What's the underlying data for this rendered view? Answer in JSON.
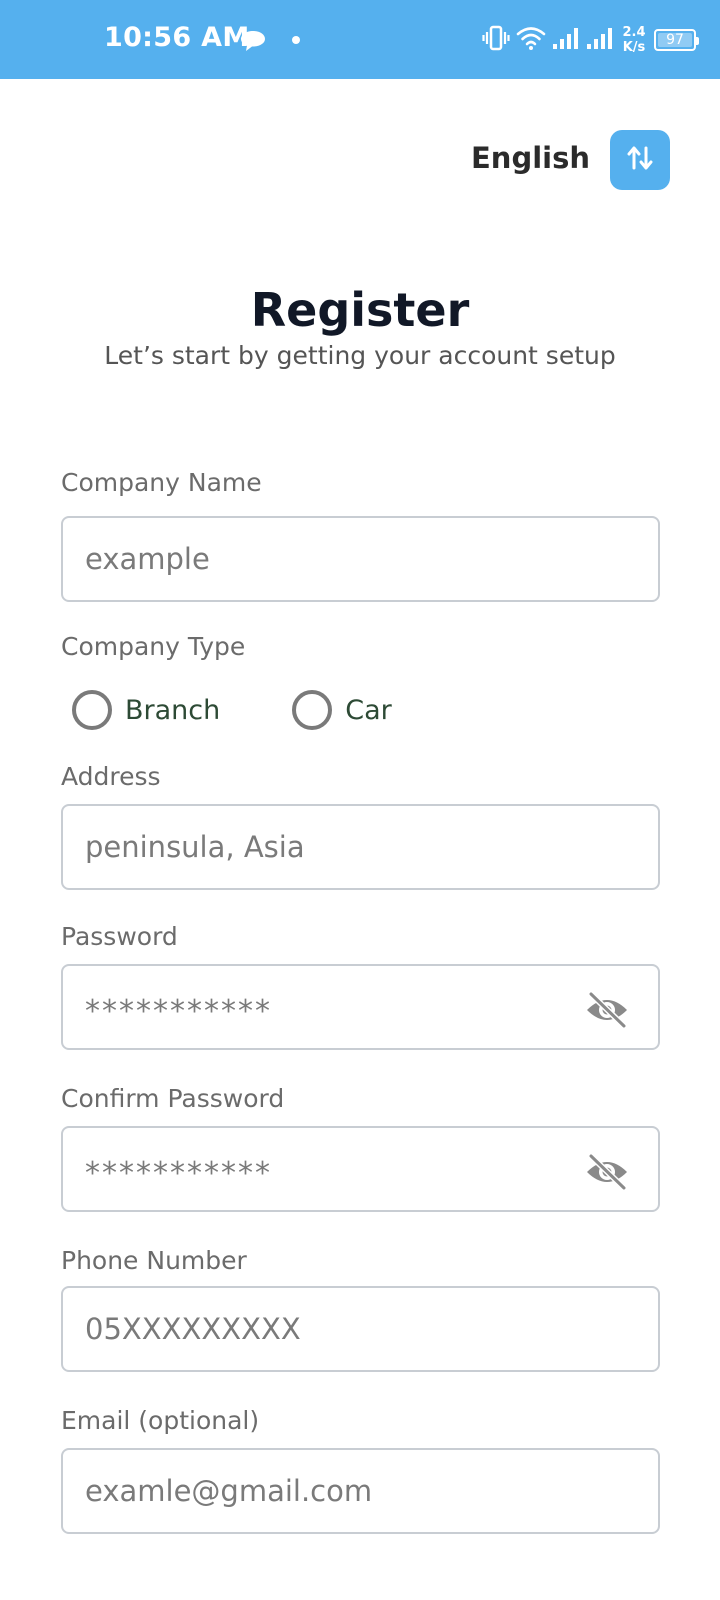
{
  "status_bar": {
    "time": "10:56 AM",
    "speed_value": "2.4",
    "speed_unit": "K/s",
    "battery": "97",
    "icons": [
      "chat-bubble-icon",
      "dot-icon",
      "vibrate-icon",
      "wifi-icon",
      "signal-icon",
      "signal-icon",
      "battery-icon"
    ]
  },
  "header": {
    "language_label": "English",
    "language_toggle_icon": "swap-vertical-icon"
  },
  "page": {
    "title": "Register",
    "subtitle": "Let’s start by getting your account setup"
  },
  "form": {
    "company_name": {
      "label": "Company Name",
      "placeholder": "example"
    },
    "company_type": {
      "label": "Company Type",
      "options": [
        {
          "label": "Branch",
          "selected": false
        },
        {
          "label": "Car",
          "selected": false
        }
      ]
    },
    "address": {
      "label": "Address",
      "placeholder": "peninsula, Asia"
    },
    "password": {
      "label": "Password",
      "placeholder": "***********",
      "toggle_icon": "eye-off-icon"
    },
    "confirm_password": {
      "label": "Confirm Password",
      "placeholder": "***********",
      "toggle_icon": "eye-off-icon"
    },
    "phone": {
      "label": "Phone Number",
      "placeholder": "05XXXXXXXXX"
    },
    "email": {
      "label": "Email (optional)",
      "placeholder": "examle@gmail.com"
    }
  },
  "colors": {
    "accent": "#55b0ee",
    "border": "#c8cdd3",
    "title": "#111827",
    "radio_text": "#2d4a35"
  }
}
